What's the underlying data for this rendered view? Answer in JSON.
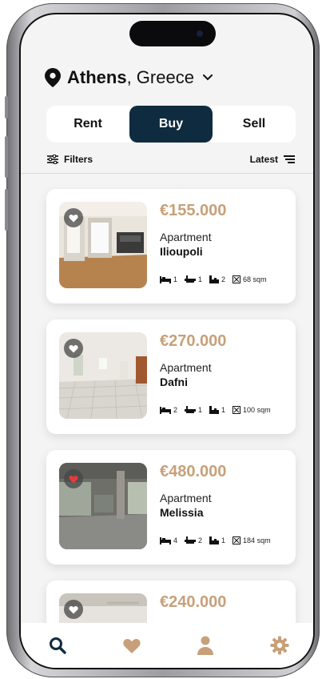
{
  "location": {
    "city": "Athens",
    "country": ", Greece"
  },
  "segments": [
    {
      "label": "Rent",
      "active": false
    },
    {
      "label": "Buy",
      "active": true
    },
    {
      "label": "Sell",
      "active": false
    }
  ],
  "toolbar": {
    "filters_label": "Filters",
    "sort_label": "Latest"
  },
  "listings": [
    {
      "price": "€155.000",
      "type": "Apartment",
      "area": "Ilioupoli",
      "beds": "1",
      "baths": "1",
      "floor": "2",
      "size": "68 sqm",
      "favorite": false
    },
    {
      "price": "€270.000",
      "type": "Apartment",
      "area": "Dafni",
      "beds": "2",
      "baths": "1",
      "floor": "1",
      "size": "100 sqm",
      "favorite": false
    },
    {
      "price": "€480.000",
      "type": "Apartment",
      "area": "Melissia",
      "beds": "4",
      "baths": "2",
      "floor": "1",
      "size": "184 sqm",
      "favorite": true
    },
    {
      "price": "€240.000",
      "type": "",
      "area": "",
      "beds": "",
      "baths": "",
      "floor": "",
      "size": "",
      "favorite": false
    }
  ],
  "colors": {
    "accent_price": "#c7a07a",
    "active_segment": "#0f2b3f",
    "tab_icon": "#c7a07a",
    "tab_active": "#0f2b3f",
    "fav_active": "#e23b3b"
  },
  "tabs": [
    {
      "icon": "search-icon",
      "active": true
    },
    {
      "icon": "heart-icon",
      "active": false
    },
    {
      "icon": "user-icon",
      "active": false
    },
    {
      "icon": "gear-icon",
      "active": false
    }
  ]
}
